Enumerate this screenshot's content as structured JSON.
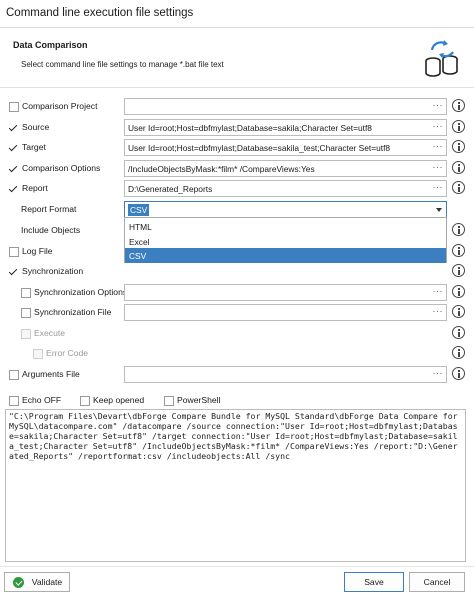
{
  "window": {
    "title": "Command line execution file settings"
  },
  "header": {
    "title": "Data Comparison",
    "subtitle": "Select command line file settings to manage *.bat file text",
    "icon": "database-sync-icon"
  },
  "options": {
    "comparison_project": {
      "label": "Comparison Project",
      "checked": false,
      "value": ""
    },
    "source": {
      "label": "Source",
      "checked": true,
      "value": "User Id=root;Host=dbfmylast;Database=sakila;Character Set=utf8"
    },
    "target": {
      "label": "Target",
      "checked": true,
      "value": "User Id=root;Host=dbfmylast;Database=sakila_test;Character Set=utf8"
    },
    "comparison_options": {
      "label": "Comparison Options",
      "checked": true,
      "value": "/IncludeObjectsByMask:*film* /CompareViews:Yes"
    },
    "report": {
      "label": "Report",
      "checked": true,
      "value": "D:\\Generated_Reports"
    },
    "report_format": {
      "label": "Report Format",
      "value": "CSV",
      "options": [
        "HTML",
        "Excel",
        "CSV"
      ]
    },
    "include_objects": {
      "label": "Include Objects"
    },
    "log_file": {
      "label": "Log File",
      "checked": false
    },
    "synchronization": {
      "label": "Synchronization",
      "checked": true
    },
    "synchronization_options": {
      "label": "Synchronization Options",
      "checked": false,
      "value": ""
    },
    "synchronization_file": {
      "label": "Synchronization File",
      "checked": false,
      "value": ""
    },
    "execute": {
      "label": "Execute",
      "checked": false
    },
    "error_code": {
      "label": "Error Code",
      "checked": false
    },
    "arguments_file": {
      "label": "Arguments File",
      "checked": false,
      "value": ""
    }
  },
  "flags": {
    "echo_off": {
      "label": "Echo OFF",
      "checked": false
    },
    "keep_opened": {
      "label": "Keep opened",
      "checked": false
    },
    "powershell": {
      "label": "PowerShell",
      "checked": false
    }
  },
  "command_text": "\"C:\\Program Files\\Devart\\dbForge Compare Bundle for MySQL Standard\\dbForge Data Compare for MySQL\\datacompare.com\" /datacompare /source connection:\"User Id=root;Host=dbfmylast;Database=sakila;Character Set=utf8\" /target connection:\"User Id=root;Host=dbfmylast;Database=sakila_test;Character Set=utf8\" /IncludeObjectsByMask:*film* /CompareViews:Yes /report:\"D:\\Generated_Reports\" /reportformat:csv /includeobjects:All /sync",
  "footer": {
    "validate_label": "Validate",
    "save_label": "Save",
    "cancel_label": "Cancel"
  },
  "colors": {
    "accent": "#3c7fc0",
    "validate_green": "#2f9a3b"
  }
}
